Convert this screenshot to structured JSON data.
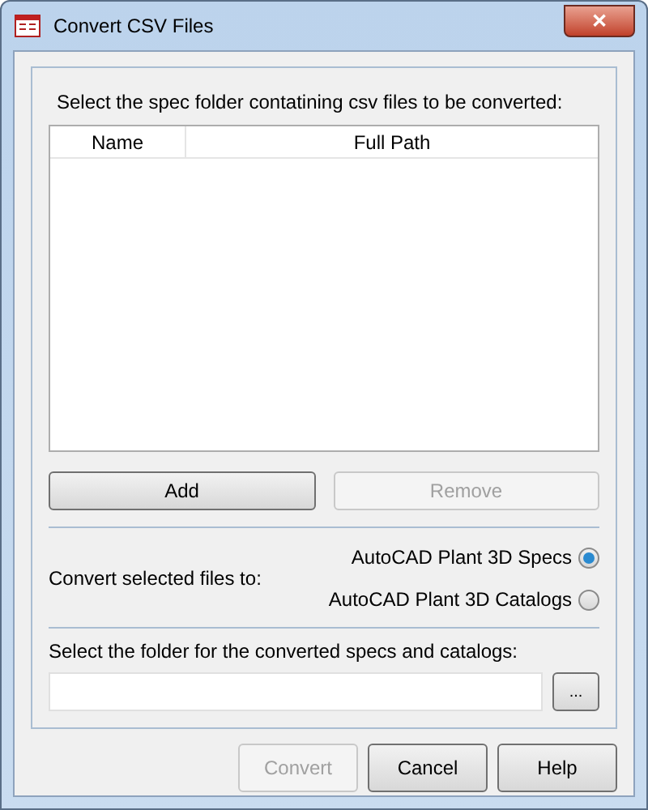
{
  "window": {
    "title": "Convert CSV Files",
    "close": "✕"
  },
  "source": {
    "label": "Select the spec folder contatining csv files to be converted:",
    "columns": [
      "Name",
      "Full Path"
    ],
    "buttons": [
      {
        "label": "Add",
        "disabled": false
      },
      {
        "label": "Remove",
        "disabled": true
      }
    ]
  },
  "convert_to": {
    "label": "Convert selected files to:",
    "options": [
      {
        "label": "AutoCAD Plant 3D Specs",
        "selected": true
      },
      {
        "label": "AutoCAD Plant 3D Catalogs",
        "selected": false
      }
    ]
  },
  "target": {
    "label": "Select the folder for the converted specs and catalogs:",
    "browse": "..."
  },
  "buttons": [
    {
      "label": "Convert",
      "disabled": true
    },
    {
      "label": "Cancel",
      "disabled": false
    },
    {
      "label": "Help",
      "disabled": false
    }
  ]
}
